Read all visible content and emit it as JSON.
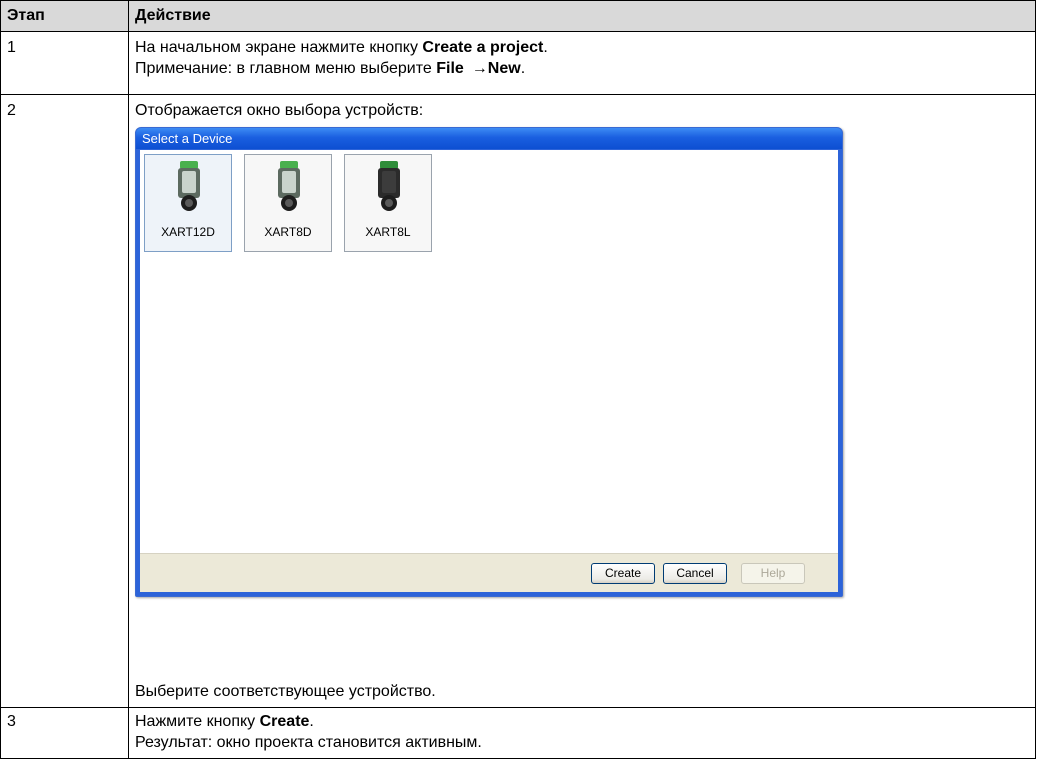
{
  "table": {
    "headers": {
      "step": "Этап",
      "action": "Действие"
    },
    "rows": [
      {
        "step": "1",
        "line1_prefix": "На начальном экране нажмите кнопку ",
        "line1_bold": "Create a project",
        "line1_suffix": ".",
        "line2_prefix": "Примечание: в главном меню выберите ",
        "line2_bold_file": "File",
        "line2_arrow": "→",
        "line2_bold_new": "New",
        "line2_suffix": "."
      },
      {
        "step": "2",
        "intro": "Отображается окно выбора устройств:",
        "outro": "Выберите соответствующее устройство."
      },
      {
        "step": "3",
        "line1_prefix": "Нажмите кнопку ",
        "line1_bold": "Create",
        "line1_suffix": ".",
        "line2": "Результат: окно проекта становится активным."
      }
    ]
  },
  "dialog": {
    "title": "Select a Device",
    "devices": [
      {
        "name": "XART12D",
        "selected": true,
        "icon": "pendant-controller-icon"
      },
      {
        "name": "XART8D",
        "selected": false,
        "icon": "pendant-controller-icon"
      },
      {
        "name": "XART8L",
        "selected": false,
        "icon": "pendant-controller-icon"
      }
    ],
    "buttons": {
      "create": "Create",
      "cancel": "Cancel",
      "help": "Help"
    }
  },
  "colors": {
    "titlebar": "#1a5fe0",
    "header_bg": "#d9d9d9",
    "footer_bg": "#ece9d8"
  }
}
